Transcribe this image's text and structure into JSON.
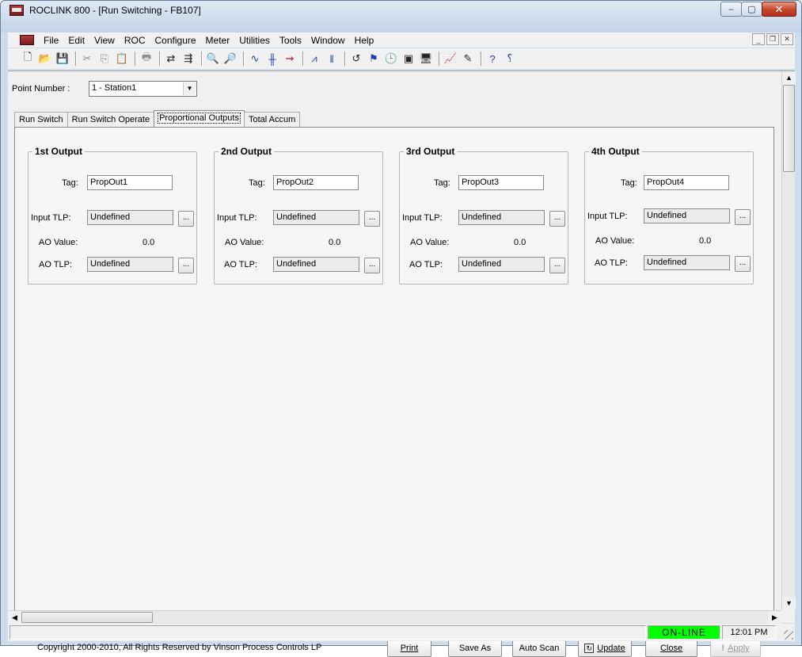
{
  "window": {
    "title": "ROCLINK 800 - [Run Switching - FB107]",
    "minimize_glyph": "–",
    "maximize_glyph": "▢",
    "close_glyph": "✕"
  },
  "menu": {
    "items": [
      "File",
      "Edit",
      "View",
      "ROC",
      "Configure",
      "Meter",
      "Utilities",
      "Tools",
      "Window",
      "Help"
    ],
    "mdi_minimize": "_",
    "mdi_restore": "❐",
    "mdi_close": "✕"
  },
  "toolbar": {
    "icons": [
      {
        "name": "new-icon",
        "glyph": "🗋"
      },
      {
        "name": "open-folder-icon",
        "glyph": "📂"
      },
      {
        "name": "save-icon",
        "glyph": "💾"
      },
      {
        "sep": true
      },
      {
        "name": "cut-icon",
        "glyph": "✂",
        "dim": true
      },
      {
        "name": "copy-icon",
        "glyph": "⎘",
        "dim": true
      },
      {
        "name": "paste-icon",
        "glyph": "📋",
        "dim": true
      },
      {
        "sep": true
      },
      {
        "name": "print-icon",
        "glyph": "🖶",
        "dim": true
      },
      {
        "sep": true
      },
      {
        "name": "connect-icon",
        "glyph": "⇄"
      },
      {
        "name": "direct-connect-icon",
        "glyph": "⇶"
      },
      {
        "sep": true
      },
      {
        "name": "zoom-in-icon",
        "glyph": "🔍",
        "dim": true
      },
      {
        "name": "zoom-out-icon",
        "glyph": "🔎",
        "dim": true
      },
      {
        "sep": true
      },
      {
        "name": "trend-icon",
        "glyph": "∿",
        "blue": true
      },
      {
        "name": "signal-icon",
        "glyph": "╫",
        "blue": true
      },
      {
        "name": "flow-icon",
        "glyph": "⇝",
        "red": true
      },
      {
        "sep": true
      },
      {
        "name": "waveform-icon",
        "glyph": "⩘",
        "blue": true
      },
      {
        "name": "bars-icon",
        "glyph": "‖",
        "blue": true
      },
      {
        "sep": true
      },
      {
        "name": "history-icon",
        "glyph": "↺"
      },
      {
        "name": "alarm-icon",
        "glyph": "⚑",
        "blue": true
      },
      {
        "name": "clock-icon",
        "glyph": "🕒"
      },
      {
        "name": "display-icon",
        "glyph": "▣"
      },
      {
        "name": "monitor-icon",
        "glyph": "🖥"
      },
      {
        "sep": true
      },
      {
        "name": "chart-icon",
        "glyph": "📈",
        "dim": true
      },
      {
        "name": "edit-icon",
        "glyph": "✎"
      },
      {
        "sep": true
      },
      {
        "name": "help-icon",
        "glyph": "?",
        "blue": true
      },
      {
        "name": "context-help-icon",
        "glyph": "⸮",
        "blue": true
      }
    ]
  },
  "point_number": {
    "label": "Point Number :",
    "value": "1 - Station1"
  },
  "tabs": [
    {
      "label": "Run Switch",
      "active": false
    },
    {
      "label": "Run Switch Operate",
      "active": false
    },
    {
      "label": "Proportional Outputs",
      "active": true
    },
    {
      "label": "Total Accum",
      "active": false
    }
  ],
  "outputs": [
    {
      "title": "1st Output",
      "tag_label": "Tag:",
      "tag": "PropOut1",
      "input_tlp_label": "Input TLP:",
      "input_tlp": "Undefined",
      "ao_value_label": "AO Value:",
      "ao_value": "0.0",
      "ao_tlp_label": "AO TLP:",
      "ao_tlp": "Undefined"
    },
    {
      "title": "2nd Output",
      "tag_label": "Tag:",
      "tag": "PropOut2",
      "input_tlp_label": "Input TLP:",
      "input_tlp": "Undefined",
      "ao_value_label": "AO Value:",
      "ao_value": "0.0",
      "ao_tlp_label": "AO TLP:",
      "ao_tlp": "Undefined"
    },
    {
      "title": "3rd Output",
      "tag_label": "Tag:",
      "tag": "PropOut3",
      "input_tlp_label": "Input TLP:",
      "input_tlp": "Undefined",
      "ao_value_label": "AO Value:",
      "ao_value": "0.0",
      "ao_tlp_label": "AO TLP:",
      "ao_tlp": "Undefined"
    },
    {
      "title": "4th Output",
      "tag_label": "Tag:",
      "tag": "PropOut4",
      "input_tlp_label": "Input TLP:",
      "input_tlp": "Undefined",
      "ao_value_label": "AO Value:",
      "ao_value": "0.0",
      "ao_tlp_label": "AO TLP:",
      "ao_tlp": "Undefined"
    }
  ],
  "tlp_button_label": "...",
  "footer": {
    "copyright": "Copyright 2000-2010, All Rights Reserved by Vinson Process Controls LP",
    "buttons": {
      "print": "Print",
      "save_as": "Save As",
      "auto_scan": "Auto Scan",
      "update": "Update",
      "close": "Close",
      "apply": "Apply"
    }
  },
  "status": {
    "connection": "ON-LINE",
    "connection_color": "#00ff00",
    "time": "12:01 PM"
  }
}
